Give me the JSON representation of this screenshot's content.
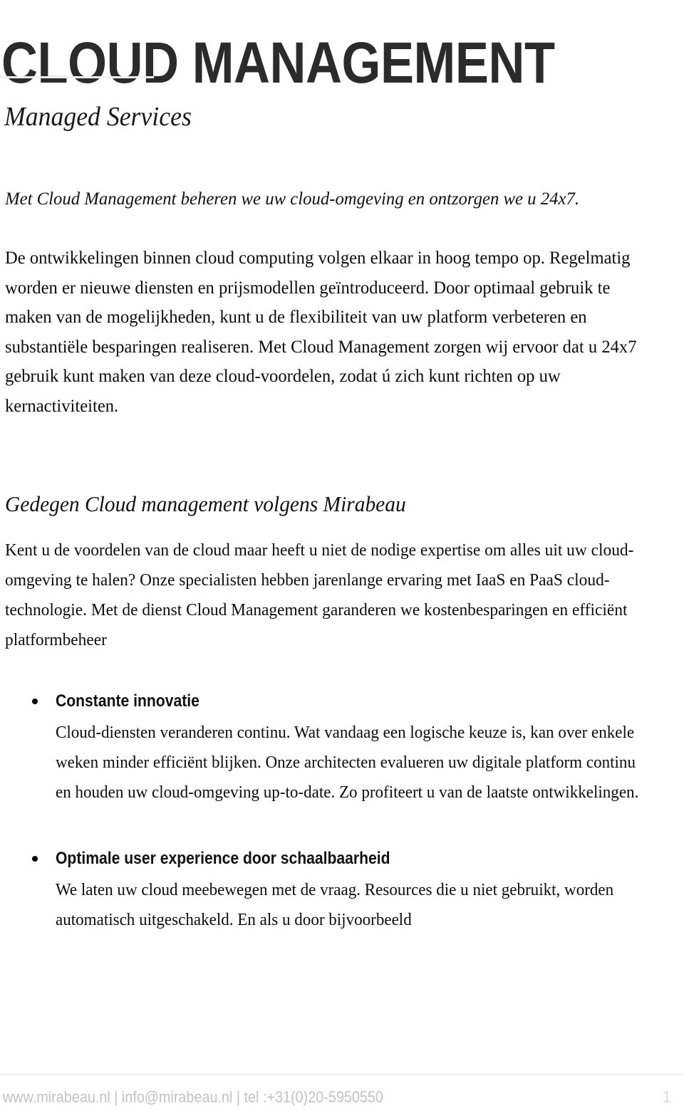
{
  "document": {
    "title": "CLOUD MANAGEMENT",
    "subtitle": "Managed Services",
    "lead": "Met Cloud Management beheren we uw cloud-omgeving en ontzorgen we u 24x7.",
    "intro_paragraph": "De ontwikkelingen binnen cloud computing volgen elkaar in hoog tempo op. Regelmatig worden er nieuwe diensten en prijsmodellen geïntroduceerd. Door optimaal gebruik te maken van de mogelijkheden, kunt u de flexibiliteit van uw platform verbeteren en substantiële besparingen realiseren. Met Cloud Management zorgen wij ervoor dat u 24x7 gebruik kunt maken van deze cloud-voordelen, zodat ú zich kunt richten op uw kernactiviteiten.",
    "section": {
      "heading": "Gedegen Cloud management volgens Mirabeau",
      "paragraph": "Kent u de voordelen van de cloud maar heeft u niet de nodige expertise om alles uit uw cloud-omgeving te halen? Onze specialisten hebben jarenlange ervaring met IaaS en PaaS cloud-technologie. Met de dienst Cloud Management garanderen we kostenbesparingen en efficiënt platformbeheer"
    },
    "bullets": [
      {
        "heading": "Constante innovatie",
        "body": "Cloud-diensten veranderen continu. Wat vandaag een logische keuze is, kan over enkele weken minder efficiënt blijken. Onze architecten evalueren uw digitale platform continu en houden uw cloud-omgeving up-to-date. Zo profiteert u van de laatste ontwikkelingen."
      },
      {
        "heading": "Optimale user experience door schaalbaarheid",
        "body": "We laten uw cloud meebewegen met de vraag. Resources die u niet gebruikt, worden automatisch uitgeschakeld. En als u door bijvoorbeeld"
      }
    ],
    "footer": {
      "contact": "www.mirabeau.nl | info@mirabeau.nl | tel :+31(0)20-5950550",
      "page_number": "1"
    },
    "colors": {
      "title": "#2b2b2b",
      "body_text": "#0d0d0d",
      "footer_text": "#c2c2c2",
      "rule": "#f0f0f0",
      "background": "#ffffff"
    }
  }
}
